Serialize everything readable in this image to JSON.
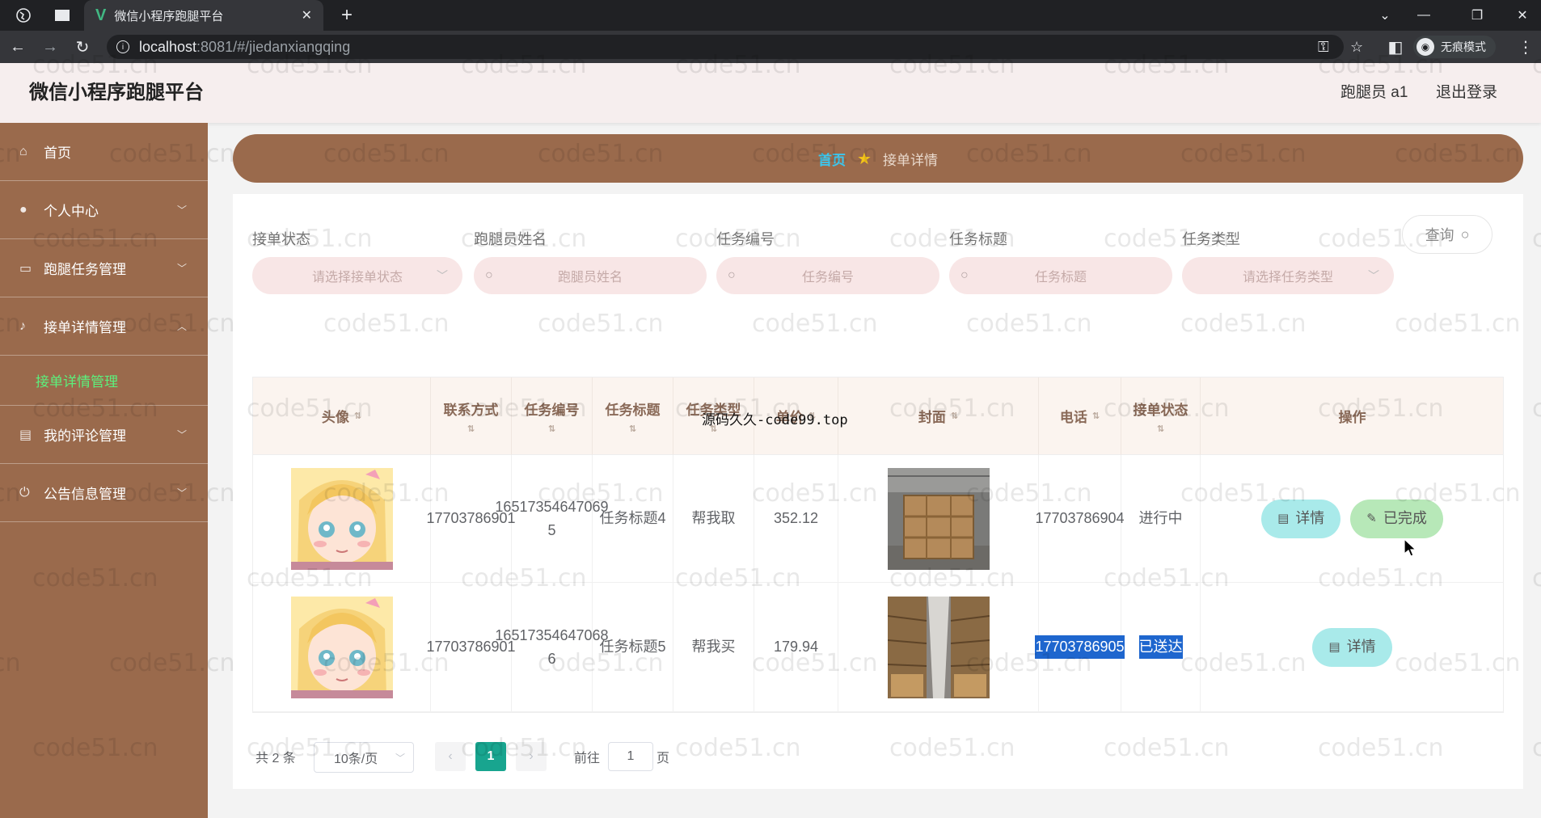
{
  "browser": {
    "tab_title": "微信小程序跑腿平台",
    "url_host": "localhost",
    "url_rest": ":8081/#/jiedanxiangqing",
    "incognito_label": "无痕模式"
  },
  "header": {
    "title": "微信小程序跑腿平台",
    "user": "跑腿员 a1",
    "logout": "退出登录"
  },
  "sidebar": {
    "items": [
      {
        "label": "首页"
      },
      {
        "label": "个人中心"
      },
      {
        "label": "跑腿任务管理"
      },
      {
        "label": "接单详情管理"
      },
      {
        "label": "我的评论管理"
      },
      {
        "label": "公告信息管理"
      }
    ],
    "active_sub": "接单详情管理"
  },
  "breadcrumb": {
    "home": "首页",
    "current": "接单详情"
  },
  "filters": {
    "status": {
      "label": "接单状态",
      "placeholder": "请选择接单状态"
    },
    "runner": {
      "label": "跑腿员姓名",
      "placeholder": "跑腿员姓名"
    },
    "task_no": {
      "label": "任务编号",
      "placeholder": "任务编号"
    },
    "task_title": {
      "label": "任务标题",
      "placeholder": "任务标题"
    },
    "task_type": {
      "label": "任务类型",
      "placeholder": "请选择任务类型"
    },
    "query": "查询"
  },
  "table": {
    "headers": {
      "avatar": "头像",
      "contact": "联系方式",
      "task_no": "任务编号",
      "task_title": "任务标题",
      "task_type": "任务类型",
      "price": "单价",
      "cover": "封面",
      "phone": "电话",
      "status": "接单状态",
      "ops": "操作"
    },
    "rows": [
      {
        "contact": "17703786901",
        "task_no": "16517354647069 5",
        "task_title": "任务标题4",
        "task_type": "帮我取",
        "price": "352.12",
        "phone": "17703786904",
        "status": "进行中",
        "btn_detail": "详情",
        "btn_done": "已完成"
      },
      {
        "contact": "17703786901",
        "task_no": "16517354647068 6",
        "task_title": "任务标题5",
        "task_type": "帮我买",
        "price": "179.94",
        "phone": "17703786905",
        "status": "已送达",
        "btn_detail": "详情"
      }
    ]
  },
  "pagination": {
    "total": "共 2 条",
    "page_size": "10条/页",
    "current": "1",
    "goto_prefix": "前往",
    "goto_value": "1",
    "goto_suffix": "页"
  },
  "watermarks": {
    "site": "code51.cn",
    "source": "源码久久-code99.top"
  },
  "colors": {
    "sidebar": "#9a6a4c",
    "header": "#f6eeee",
    "accent": "#18a58f",
    "highlight": "#1e66ce"
  }
}
